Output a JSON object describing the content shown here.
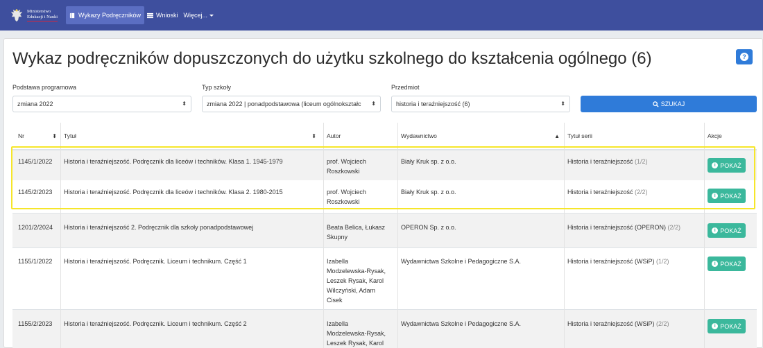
{
  "navbar": {
    "logo_line1": "Ministerstwo",
    "logo_line2": "Edukacji i Nauki",
    "items": [
      {
        "label": "Wykazy Podręczników"
      },
      {
        "label": "Wnioski"
      },
      {
        "label": "Więcej..."
      }
    ]
  },
  "page": {
    "title": "Wykaz podręczników dopuszczonych do użytku szkolnego do kształcenia ogólnego (6)",
    "help_label": "?"
  },
  "filters": {
    "podstawa": {
      "label": "Podstawa programowa",
      "value": "zmiana 2022"
    },
    "typ": {
      "label": "Typ szkoły",
      "value": "zmiana 2022 | ponadpodstawowa (liceum ogólnokształc"
    },
    "przedmiot": {
      "label": "Przedmiot",
      "value": "historia i teraźniejszość (6)"
    },
    "search_label": "SZUKAJ"
  },
  "table": {
    "headers": {
      "nr": "Nr",
      "tytul": "Tytuł",
      "autor": "Autor",
      "wydawnictwo": "Wydawnictwo",
      "seria": "Tytuł serii",
      "akcje": "Akcje"
    },
    "rows": [
      {
        "nr": "1145/1/2022",
        "tytul": "Historia i teraźniejszość. Podręcznik dla liceów i techników. Klasa 1. 1945-1979",
        "autor": [
          "prof. Wojciech",
          "Roszkowski"
        ],
        "wydawnictwo": "Biały Kruk sp. z o.o.",
        "seria": "Historia i teraźniejszość",
        "seria_part": "(1/2)",
        "action": "POKAŻ"
      },
      {
        "nr": "1145/2/2023",
        "tytul": "Historia i teraźniejszość. Podręcznik dla liceów i techników. Klasa 2. 1980-2015",
        "autor": [
          "prof. Wojciech",
          "Roszkowski"
        ],
        "wydawnictwo": "Biały Kruk sp. z o.o.",
        "seria": "Historia i teraźniejszość",
        "seria_part": "(2/2)",
        "action": "POKAŻ"
      },
      {
        "nr": "1201/2/2024",
        "tytul": "Historia i teraźniejszość 2. Podręcznik dla szkoły ponadpodstawowej",
        "autor": [
          "Beata Belica, Łukasz",
          "Skupny"
        ],
        "wydawnictwo": "OPERON Sp. z o.o.",
        "seria": "Historia i teraźniejszość (OPERON)",
        "seria_part": "(2/2)",
        "action": "POKAŻ"
      },
      {
        "nr": "1155/1/2022",
        "tytul": "Historia i teraźniejszość. Podręcznik. Liceum i technikum. Część 1",
        "autor": [
          "Izabella",
          "Modzelewska-Rysak,",
          "Leszek Rysak, Karol",
          "Wilczyński, Adam",
          "Cisek"
        ],
        "wydawnictwo": "Wydawnictwa Szkolne i Pedagogiczne S.A.",
        "seria": "Historia i teraźniejszość (WSiP)",
        "seria_part": "(1/2)",
        "action": "POKAŻ"
      },
      {
        "nr": "1155/2/2023",
        "tytul": "Historia i teraźniejszość. Podręcznik. Liceum i technikum. Część 2",
        "autor": [
          "Izabella",
          "Modzelewska-Rysak,",
          "Leszek Rysak, Karol"
        ],
        "wydawnictwo": "Wydawnictwa Szkolne i Pedagogiczne S.A.",
        "seria": "Historia i teraźniejszość (WSiP)",
        "seria_part": "(2/2)",
        "action": "POKAŻ"
      }
    ]
  },
  "colors": {
    "navbar": "#3e4f9e",
    "primary": "#2f7bd9",
    "success": "#3bb89c",
    "highlight": "#f6e62a"
  }
}
